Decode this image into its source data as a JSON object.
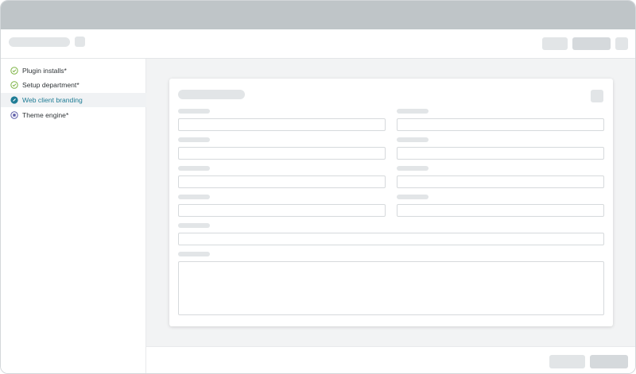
{
  "sidebar": {
    "items": [
      {
        "label": "Plugin installs*",
        "icon": "check-circle-icon",
        "status": "complete"
      },
      {
        "label": "Setup department*",
        "icon": "check-circle-icon",
        "status": "complete"
      },
      {
        "label": "Web client branding",
        "icon": "pencil-circle-icon",
        "status": "active"
      },
      {
        "label": "Theme engine*",
        "icon": "pending-circle-icon",
        "status": "pending"
      }
    ]
  },
  "colors": {
    "accent": "#1e7c95",
    "success": "#7cb342",
    "pending": "#5c5ca8",
    "titlebar": "#bfc5c8"
  }
}
